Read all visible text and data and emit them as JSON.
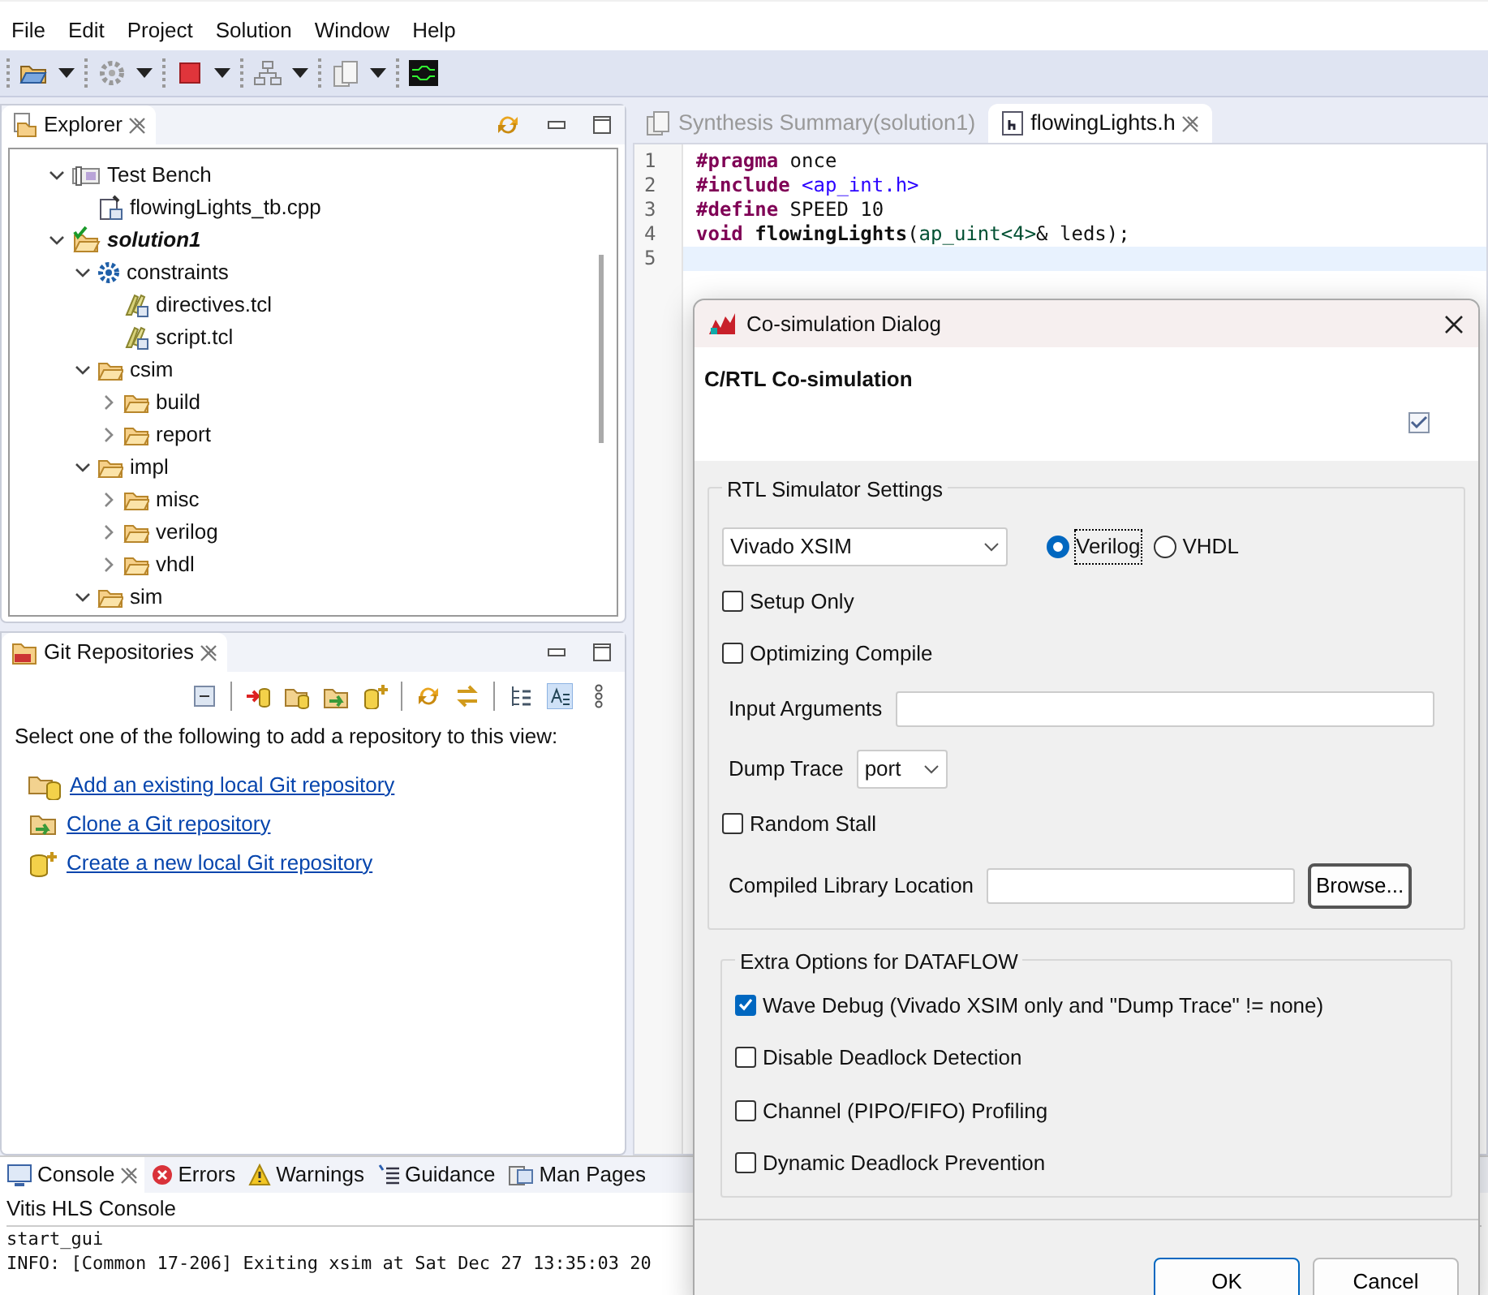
{
  "menu": [
    "File",
    "Edit",
    "Project",
    "Solution",
    "Window",
    "Help"
  ],
  "explorer": {
    "title": "Explorer",
    "tree": [
      {
        "label": "Test Bench",
        "kind": "testbench",
        "expanded": true,
        "children": [
          {
            "label": "flowingLights_tb.cpp",
            "kind": "cpp"
          }
        ]
      },
      {
        "label": "solution1",
        "kind": "solution",
        "emphasis": true,
        "expanded": true,
        "children": [
          {
            "label": "constraints",
            "kind": "gear",
            "expanded": true,
            "children": [
              {
                "label": "directives.tcl",
                "kind": "tcl"
              },
              {
                "label": "script.tcl",
                "kind": "tcl"
              }
            ]
          },
          {
            "label": "csim",
            "kind": "folder",
            "expanded": true,
            "children": [
              {
                "label": "build",
                "kind": "folder",
                "expanded": false
              },
              {
                "label": "report",
                "kind": "folder",
                "expanded": false
              }
            ]
          },
          {
            "label": "impl",
            "kind": "folder",
            "expanded": true,
            "children": [
              {
                "label": "misc",
                "kind": "folder",
                "expanded": false
              },
              {
                "label": "verilog",
                "kind": "folder",
                "expanded": false
              },
              {
                "label": "vhdl",
                "kind": "folder",
                "expanded": false
              }
            ]
          },
          {
            "label": "sim",
            "kind": "folder",
            "expanded": true
          }
        ]
      }
    ]
  },
  "git": {
    "title": "Git Repositories",
    "prompt": "Select one of the following to add a repository to this view:",
    "links": [
      {
        "label": "Add an existing local Git repository",
        "kind": "add"
      },
      {
        "label": "Clone a Git repository",
        "kind": "clone"
      },
      {
        "label": "Create a new local Git repository",
        "kind": "create"
      }
    ]
  },
  "editor": {
    "tabs": [
      {
        "label": "Synthesis Summary(solution1)",
        "kind": "report",
        "selected": false
      },
      {
        "label": "flowingLights.h",
        "kind": "header",
        "selected": true
      }
    ],
    "lines": [
      {
        "number": "1",
        "current": false,
        "tokens": [
          {
            "text": "#pragma",
            "kind": "directive"
          },
          {
            "text": " once",
            "kind": "plain"
          }
        ]
      },
      {
        "number": "2",
        "current": false,
        "tokens": [
          {
            "text": "#include",
            "kind": "directive"
          },
          {
            "text": " <ap_int.h>",
            "kind": "string"
          }
        ]
      },
      {
        "number": "3",
        "current": false,
        "tokens": [
          {
            "text": "#define",
            "kind": "directive"
          },
          {
            "text": " SPEED 10",
            "kind": "plain"
          }
        ]
      },
      {
        "number": "4",
        "current": false,
        "tokens": [
          {
            "text": "void",
            "kind": "keyword"
          },
          {
            "text": " flowingLights",
            "kind": "function"
          },
          {
            "text": "(",
            "kind": "plain"
          },
          {
            "text": "ap_uint<4>",
            "kind": "type"
          },
          {
            "text": "& leds);",
            "kind": "plain"
          }
        ]
      },
      {
        "number": "5",
        "current": true
      }
    ]
  },
  "console": {
    "tabs": [
      {
        "label": "Console",
        "kind": "console",
        "selected": true
      },
      {
        "label": "Errors",
        "kind": "error",
        "selected": false
      },
      {
        "label": "Warnings",
        "kind": "warning",
        "selected": false
      },
      {
        "label": "Guidance",
        "kind": "guidance",
        "selected": false
      },
      {
        "label": "Man Pages",
        "kind": "manpages",
        "selected": false
      }
    ],
    "title": "Vitis HLS Console",
    "lines": [
      "start_gui",
      "INFO: [Common 17-206] Exiting xsim at Sat Dec 27 13:35:03 20"
    ]
  },
  "dialog": {
    "title": "Co-simulation Dialog",
    "heading": "C/RTL Co-simulation",
    "header_checked": true,
    "rtl_settings": {
      "legend": "RTL Simulator Settings",
      "simulator": "Vivado XSIM",
      "languages": [
        {
          "label": "Verilog",
          "selected": true,
          "focused": true
        },
        {
          "label": "VHDL",
          "selected": false,
          "focused": false
        }
      ],
      "rows": [
        {
          "kind": "checkbox",
          "label": "Setup Only",
          "checked": false
        },
        {
          "kind": "checkbox",
          "label": "Optimizing Compile",
          "checked": false
        },
        {
          "kind": "input",
          "label": "Input Arguments"
        },
        {
          "kind": "select",
          "label": "Dump Trace",
          "value": "port"
        },
        {
          "kind": "checkbox",
          "label": "Random Stall",
          "checked": false
        },
        {
          "kind": "file",
          "label": "Compiled Library Location",
          "button": "Browse..."
        }
      ]
    },
    "dataflow": {
      "legend": "Extra Options for DATAFLOW",
      "options": [
        {
          "label": "Wave Debug (Vivado XSIM only and \"Dump Trace\" != none)",
          "checked": true
        },
        {
          "label": "Disable Deadlock Detection",
          "checked": false
        },
        {
          "label": "Channel (PIPO/FIFO) Profiling",
          "checked": false
        },
        {
          "label": "Dynamic Deadlock Prevention",
          "checked": false
        }
      ]
    },
    "buttons": [
      "OK",
      "Cancel"
    ]
  }
}
